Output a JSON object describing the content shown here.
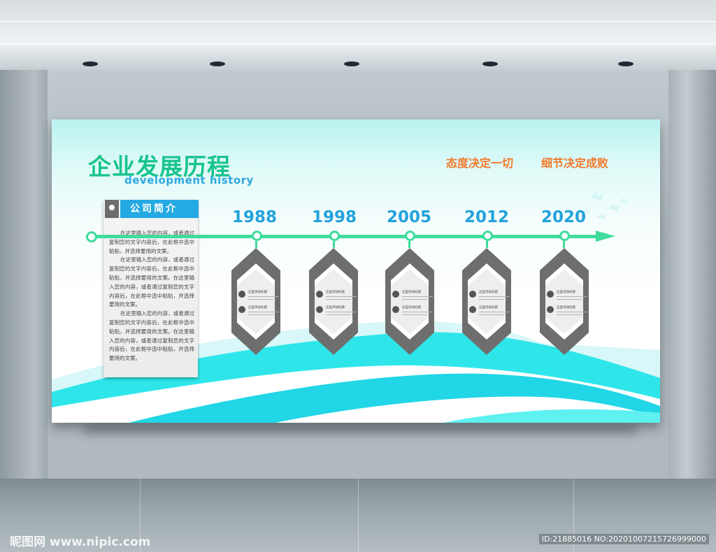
{
  "title": "企业发展历程",
  "subtitle": "development history",
  "slogans": [
    "态度决定一切",
    "细节决定成败"
  ],
  "intro": {
    "heading": "公司简介",
    "paragraphs": [
      "在这里输入您的内容，或者通过复制您的文字内容后，在此框中选中粘贴，并选择要用的文案。",
      "在这里输入您的内容，或者通过复制您的文字内容后，在此框中选中粘贴，并选择要用的文案。在这里输入您的内容，或者通过复制您的文字内容后，在此框中选中粘贴，并选择要用的文案。",
      "在这里输入您的内容，或者通过复制您的文字内容后，在此框中选中粘贴，并选择要用的文案。在这里输入您的内容，或者通过复制您的文字内容后，在此框中选中粘贴，并选择要用的文案。"
    ]
  },
  "timeline": [
    {
      "year": "1988",
      "rows": [
        {
          "title": "这里添加标题",
          "text": "在这里输入您的内容"
        },
        {
          "title": "这里添加标题",
          "text": "在这里输入您的内容"
        }
      ]
    },
    {
      "year": "1998",
      "rows": [
        {
          "title": "这里添加标题",
          "text": "在这里输入您的内容"
        },
        {
          "title": "这里添加标题",
          "text": "在这里输入您的内容"
        }
      ]
    },
    {
      "year": "2005",
      "rows": [
        {
          "title": "这里添加标题",
          "text": "在这里输入您的内容"
        },
        {
          "title": "这里添加标题",
          "text": "在这里输入您的内容"
        }
      ]
    },
    {
      "year": "2012",
      "rows": [
        {
          "title": "这里添加标题",
          "text": "在这里输入您的内容"
        },
        {
          "title": "这里添加标题",
          "text": "在这里输入您的内容"
        }
      ]
    },
    {
      "year": "2020",
      "rows": [
        {
          "title": "这里添加标题",
          "text": "在这里输入您的内容"
        },
        {
          "title": "这里添加标题",
          "text": "在这里输入您的内容"
        }
      ]
    }
  ],
  "watermark_left": "昵图网 www.nipic.com",
  "watermark_right": "ID:21885016 NO:20201007215726999000",
  "colors": {
    "title": "#19c48c",
    "accent_blue": "#24a9e2",
    "timeline": "#3fdc9b",
    "slogan": "#f2792a",
    "card_gray": "#6e6e6e",
    "wave": "#2ee6ea"
  }
}
